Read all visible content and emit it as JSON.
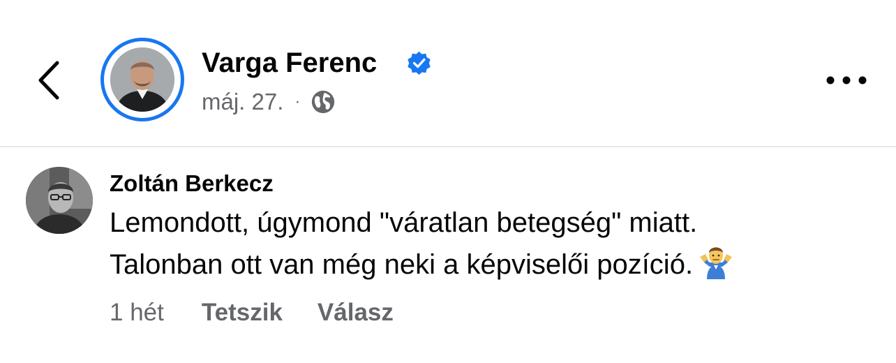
{
  "post_header": {
    "author": "Varga Ferenc",
    "date": "máj. 27.",
    "separator": "·",
    "verified_icon": "verified-badge-icon",
    "audience_icon": "globe-icon",
    "back_icon": "chevron-left-icon",
    "more_icon": "more-dots-icon"
  },
  "comment": {
    "author": "Zoltán Berkecz",
    "lines": [
      "Lemondott, úgymond \"váratlan betegség\" miatt.",
      "Talonban ott van még neki a képviselői pozíció."
    ],
    "emoji_icon": "man-shrugging-icon",
    "time": "1 hét",
    "like_label": "Tetszik",
    "reply_label": "Válasz"
  },
  "colors": {
    "accent": "#1877f2",
    "secondary_text": "#65676b",
    "divider": "#e4e6eb"
  }
}
